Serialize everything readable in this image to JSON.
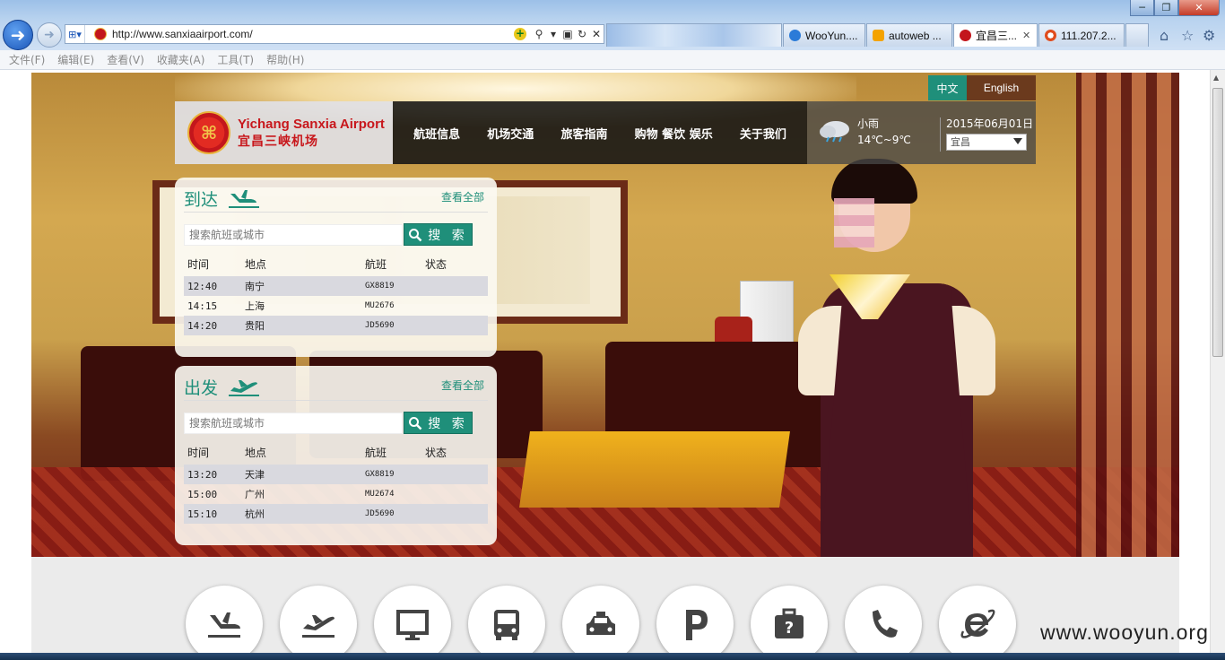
{
  "browser": {
    "url": "http://www.sanxiaairport.com/",
    "tabs": [
      {
        "label": "",
        "blurred": true
      },
      {
        "label": "WooYun....",
        "favicon_color": "#2b7bd8"
      },
      {
        "label": "autoweb ...",
        "favicon_color": "#f4a300"
      },
      {
        "label": "宜昌三...",
        "favicon_color": "#c3161c",
        "active": true,
        "close": "✕"
      },
      {
        "label": "111.207.2...",
        "favicon_color": "#e04b1c"
      }
    ],
    "menu": [
      "文件(F)",
      "编辑(E)",
      "查看(V)",
      "收藏夹(A)",
      "工具(T)",
      "帮助(H)"
    ],
    "window_buttons": {
      "minimize": "─",
      "maximize": "❐",
      "close": "✕"
    },
    "right_icons": [
      "home-icon",
      "star-icon",
      "gear-icon"
    ]
  },
  "site": {
    "lang": {
      "cn": "中文",
      "en": "English"
    },
    "logo": {
      "en": "Yichang Sanxia Airport",
      "cn": "宜昌三峡机场"
    },
    "nav": [
      "航班信息",
      "机场交通",
      "旅客指南",
      "购物 餐饮 娱乐",
      "关于我们"
    ],
    "weather": {
      "desc": "小雨",
      "temp": "14℃~9℃",
      "date": "2015年06月01日",
      "city": "宜昌"
    },
    "accent_color": "#1f8f7a",
    "brand_color": "#c8171c"
  },
  "arrivals": {
    "title": "到达",
    "view_all": "查看全部",
    "search_placeholder": "搜索航班或城市",
    "search_button": "搜 索",
    "columns": [
      "时间",
      "地点",
      "航班",
      "状态"
    ],
    "rows": [
      {
        "time": "12:40",
        "place": "南宁",
        "flight": "GX8819",
        "status": ""
      },
      {
        "time": "14:15",
        "place": "上海",
        "flight": "MU2676",
        "status": ""
      },
      {
        "time": "14:20",
        "place": "贵阳",
        "flight": "JD5690",
        "status": ""
      }
    ]
  },
  "departures": {
    "title": "出发",
    "view_all": "查看全部",
    "search_placeholder": "搜索航班或城市",
    "search_button": "搜 索",
    "columns": [
      "时间",
      "地点",
      "航班",
      "状态"
    ],
    "rows": [
      {
        "time": "13:20",
        "place": "天津",
        "flight": "GX8819",
        "status": ""
      },
      {
        "time": "15:00",
        "place": "广州",
        "flight": "MU2674",
        "status": ""
      },
      {
        "time": "15:10",
        "place": "杭州",
        "flight": "JD5690",
        "status": ""
      }
    ]
  },
  "services": [
    "arrival-plane-icon",
    "departure-plane-icon",
    "monitor-icon",
    "bus-icon",
    "taxi-icon",
    "parking-icon",
    "luggage-help-icon",
    "phone-icon",
    "ie-icon"
  ],
  "watermark": "www.wooyun.org"
}
